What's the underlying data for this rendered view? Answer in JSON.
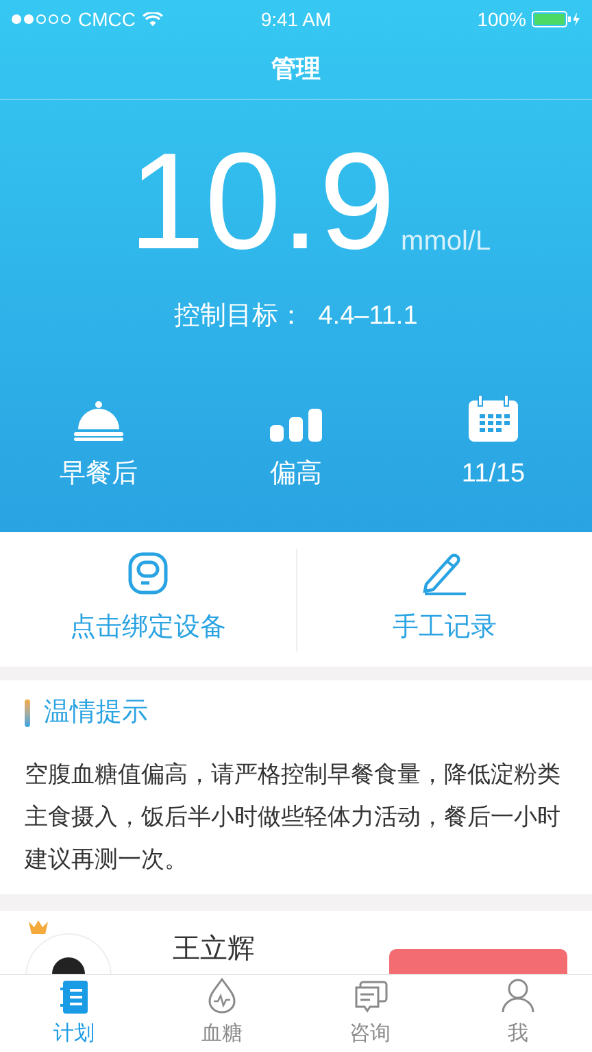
{
  "status_bar": {
    "carrier": "CMCC",
    "time": "9:41 AM",
    "battery": "100%"
  },
  "nav": {
    "title": "管理"
  },
  "reading": {
    "value": "10.9",
    "unit": "mmol/L",
    "target_label": "控制目标：",
    "target_value": "4.4–11.1"
  },
  "stats": [
    {
      "kind": "meal",
      "label": "早餐后"
    },
    {
      "kind": "level",
      "label": "偏高"
    },
    {
      "kind": "date",
      "label": "11/15"
    }
  ],
  "actions": [
    {
      "kind": "device",
      "label": "点击绑定设备"
    },
    {
      "kind": "manual",
      "label": "手工记录"
    }
  ],
  "tip": {
    "title": "温情提示",
    "text": "空腹血糖值偏高，请严格控制早餐食量，降低淀粉类主食摄入，饭后半小时做些轻体力活动，餐后一小时建议再测一次。"
  },
  "doctor": {
    "name": "王立辉"
  },
  "tabs": [
    {
      "kind": "plan",
      "label": "计划",
      "selected": true
    },
    {
      "kind": "glucose",
      "label": "血糖",
      "selected": false
    },
    {
      "kind": "consult",
      "label": "咨询",
      "selected": false
    },
    {
      "kind": "me",
      "label": "我",
      "selected": false
    }
  ]
}
